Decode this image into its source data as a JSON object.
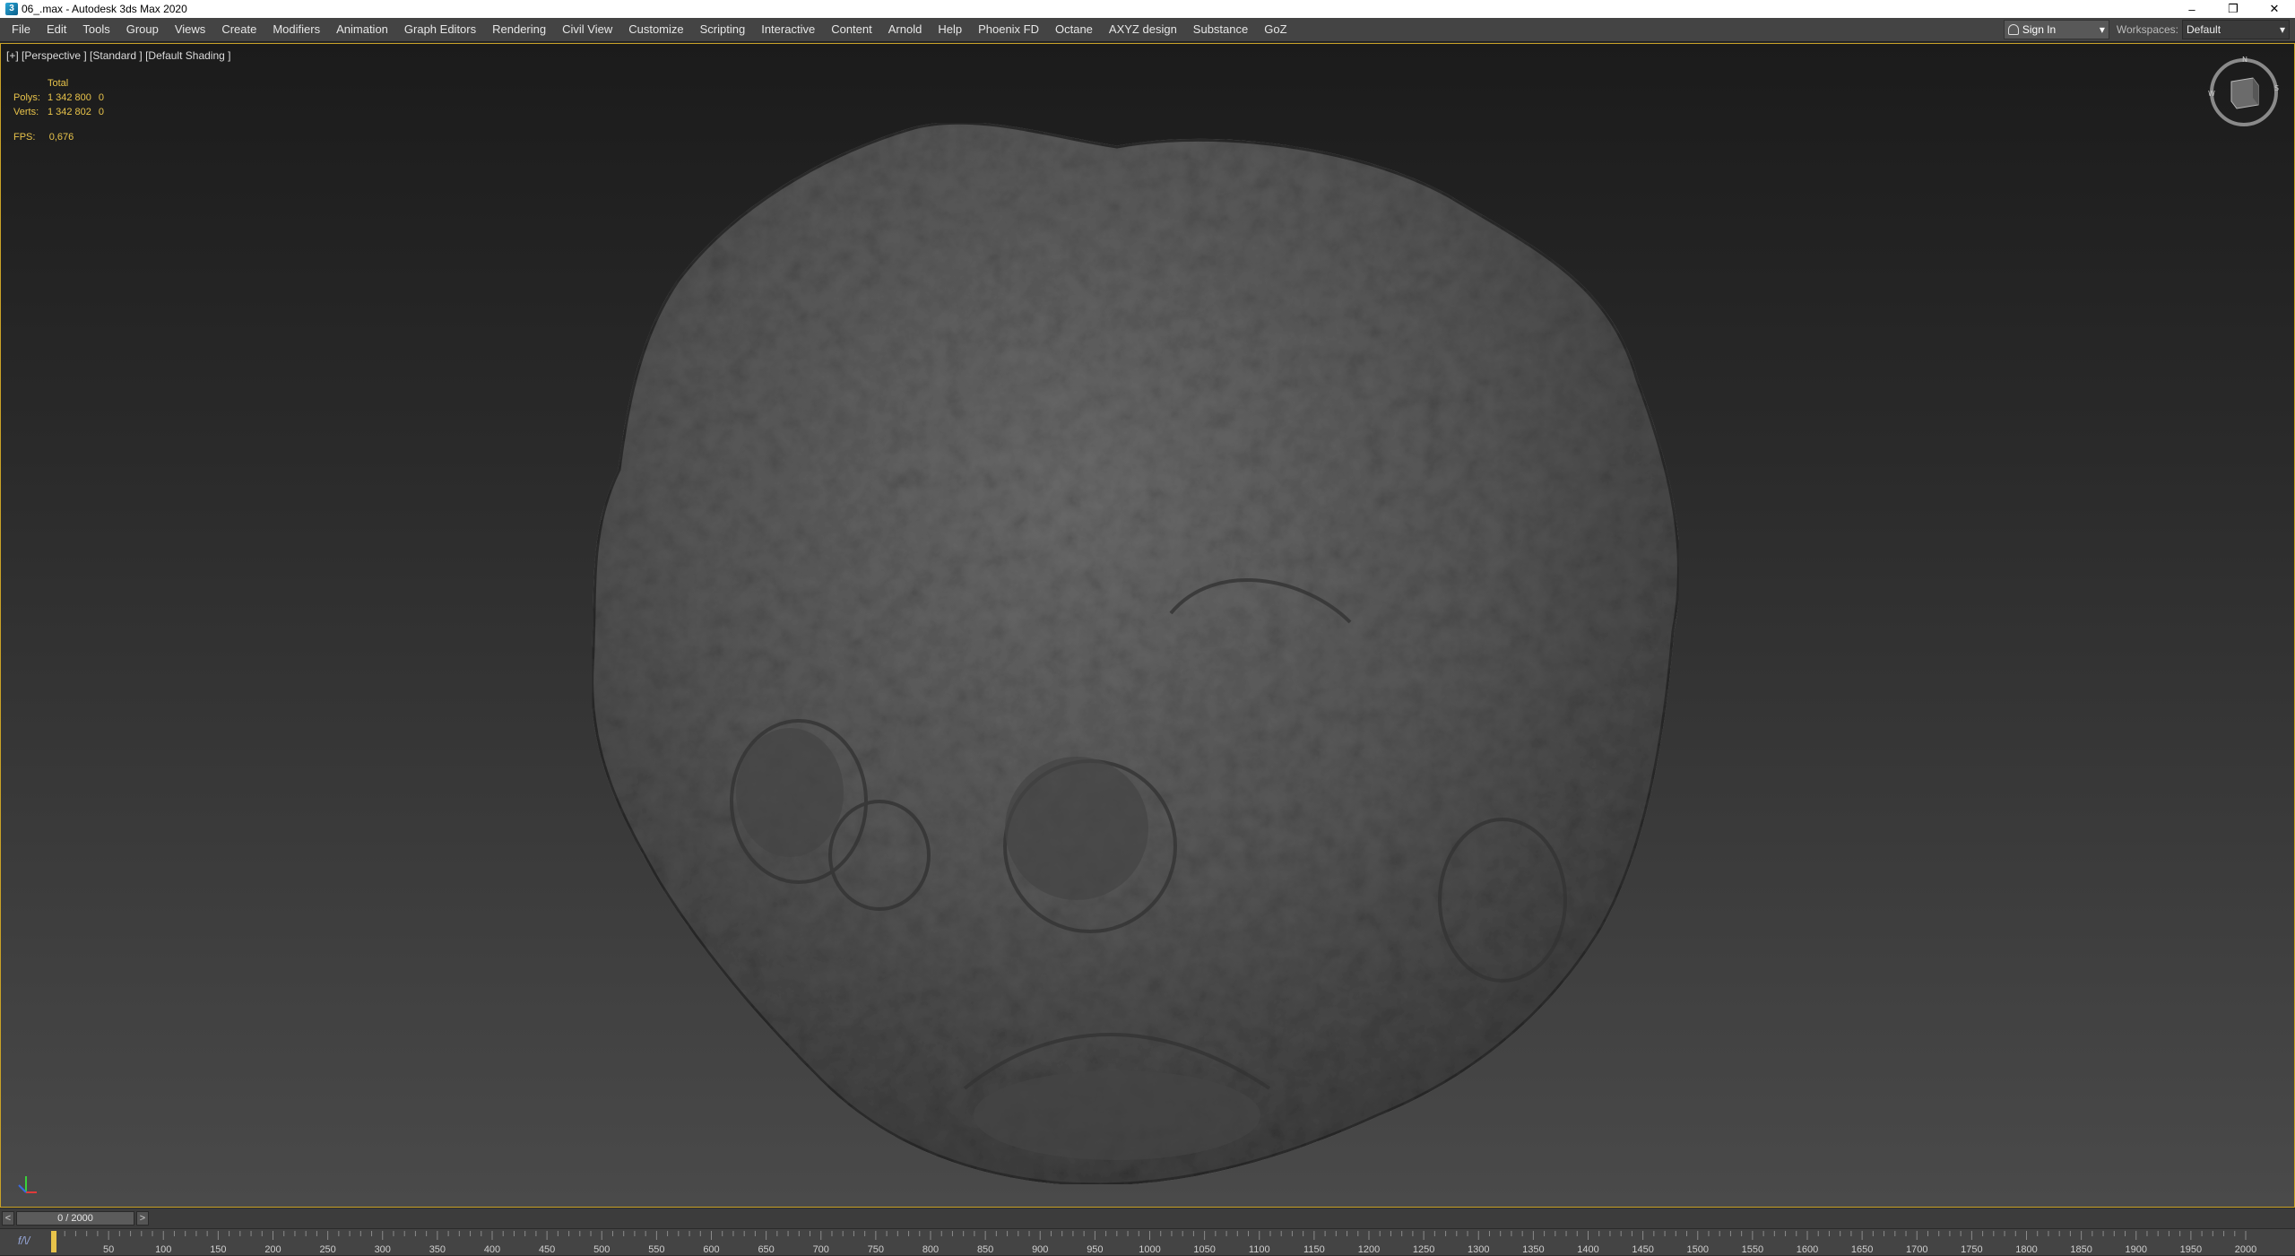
{
  "window": {
    "title": "06_.max - Autodesk 3ds Max 2020",
    "app_icon": "3",
    "minimize": "–",
    "restore": "❐",
    "close": "✕"
  },
  "menu": {
    "items": [
      "File",
      "Edit",
      "Tools",
      "Group",
      "Views",
      "Create",
      "Modifiers",
      "Animation",
      "Graph Editors",
      "Rendering",
      "Civil View",
      "Customize",
      "Scripting",
      "Interactive",
      "Content",
      "Arnold",
      "Help",
      "Phoenix FD",
      "Octane",
      "AXYZ design",
      "Substance",
      "GoZ"
    ],
    "sign_in": "Sign In",
    "workspaces_label": "Workspaces:",
    "workspaces_value": "Default"
  },
  "viewport": {
    "label": "[+] [Perspective ] [Standard ] [Default Shading ]",
    "stats": {
      "total_label": "Total",
      "polys_label": "Polys:",
      "polys_total": "1 342 800",
      "polys_sel": "0",
      "verts_label": "Verts:",
      "verts_total": "1 342 802",
      "verts_sel": "0",
      "fps_label": "FPS:",
      "fps_value": "0,676"
    },
    "accent": "#c9a227"
  },
  "timeline": {
    "prev": "<",
    "next": ">",
    "frame_display": "0 / 2000",
    "current_frame": 0,
    "max_frame": 2000,
    "ticks": [
      "50",
      "100",
      "150",
      "200",
      "250",
      "300",
      "350",
      "400",
      "450",
      "500",
      "550",
      "600",
      "650",
      "700",
      "750",
      "800",
      "850",
      "900",
      "950",
      "1000",
      "1050",
      "1100",
      "1150",
      "1200",
      "1250",
      "1300",
      "1350",
      "1400",
      "1450",
      "1500",
      "1550",
      "1600",
      "1650",
      "1700",
      "1750",
      "1800",
      "1850",
      "1900",
      "1950",
      "2000"
    ]
  }
}
